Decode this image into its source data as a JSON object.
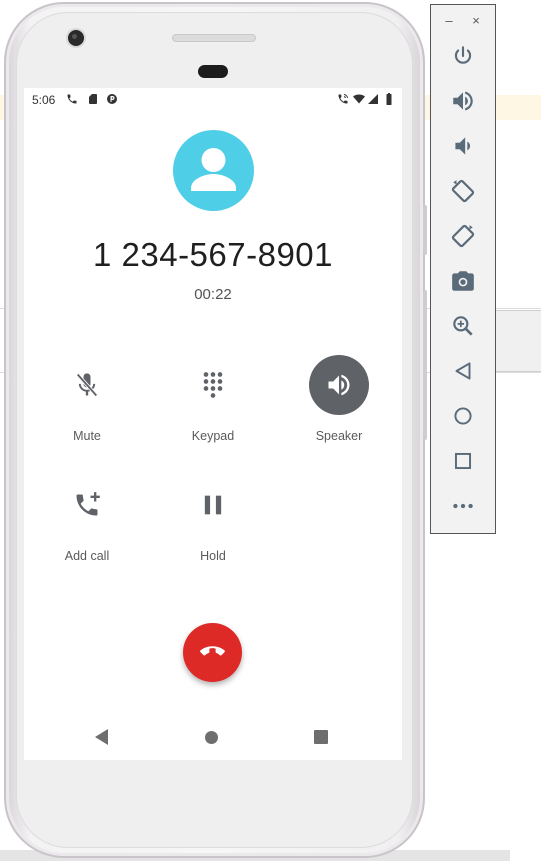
{
  "status_bar": {
    "time": "5:06",
    "left_icons": [
      "phone-icon",
      "sd-card-icon",
      "data-saver-icon"
    ],
    "right_icons": [
      "call-wifi-icon",
      "wifi-icon",
      "signal-icon",
      "battery-icon"
    ]
  },
  "call": {
    "number": "1 234-567-8901",
    "duration": "00:22",
    "avatar_color": "#4ecfe7"
  },
  "controls": [
    {
      "label": "Mute",
      "icon": "mic-off-icon",
      "active": false
    },
    {
      "label": "Keypad",
      "icon": "dialpad-icon",
      "active": false
    },
    {
      "label": "Speaker",
      "icon": "speaker-icon",
      "active": true
    },
    {
      "label": "Add call",
      "icon": "add-call-icon",
      "active": false
    },
    {
      "label": "Hold",
      "icon": "pause-icon",
      "active": false
    }
  ],
  "end_call": {
    "icon": "call-end-icon",
    "color": "#de2a27"
  },
  "nav_bar": [
    "back-triangle-icon",
    "home-circle-icon",
    "recents-square-icon"
  ],
  "emulator_toolbar": {
    "window_controls": {
      "minimize": "–",
      "close": "×"
    },
    "buttons": [
      "power-icon",
      "volume-up-icon",
      "volume-down-icon",
      "rotate-left-icon",
      "rotate-right-icon",
      "camera-icon",
      "zoom-icon",
      "back-icon",
      "home-icon",
      "overview-icon",
      "more-icon"
    ]
  }
}
